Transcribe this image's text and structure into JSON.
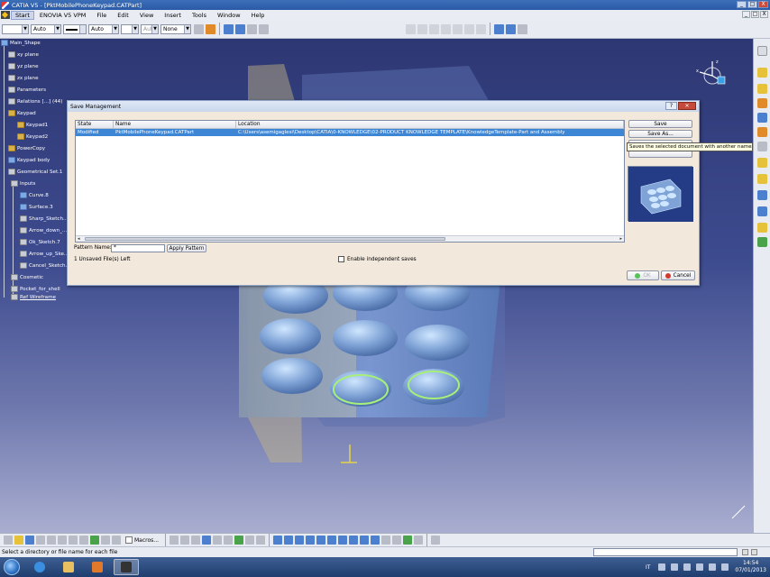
{
  "window": {
    "title": "CATIA V5 - [PktMobilePhoneKeypad.CATPart]",
    "controls": [
      "_",
      "□",
      "X"
    ]
  },
  "menu": {
    "items": [
      "Start",
      "ENOVIA V5 VPM",
      "File",
      "Edit",
      "View",
      "Insert",
      "Tools",
      "Window",
      "Help"
    ]
  },
  "toolbar": {
    "color_combo": "",
    "transparency_combo": "Auto",
    "linetype_combo": "Auto",
    "thickness_combo": "",
    "point_combo": "Aut",
    "layer_combo": "None"
  },
  "tree": {
    "nodes": [
      {
        "label": "Main_Shape",
        "icon": "part-icon"
      },
      {
        "label": "xy plane",
        "icon": "plane-icon"
      },
      {
        "label": "yz plane",
        "icon": "plane-icon"
      },
      {
        "label": "zx plane",
        "icon": "plane-icon"
      },
      {
        "label": "Parameters",
        "icon": "parameters-icon"
      },
      {
        "label": "Relations [...] (44)",
        "icon": "relations-icon"
      },
      {
        "label": "Keypad",
        "icon": "body-icon"
      },
      {
        "label": "Keypad1",
        "icon": "feature-icon"
      },
      {
        "label": "Keypad2",
        "icon": "feature-icon"
      },
      {
        "label": "PowerCopy",
        "icon": "powercopy-icon"
      },
      {
        "label": "Keypad body",
        "icon": "body-icon"
      },
      {
        "label": "Geometrical Set.1",
        "icon": "geoset-icon"
      },
      {
        "label": "Inputs",
        "icon": "geoset-icon"
      },
      {
        "label": "Curve.8",
        "icon": "curve-icon"
      },
      {
        "label": "Surface.3",
        "icon": "surface-icon"
      },
      {
        "label": "Sharp_Sketch...",
        "icon": "sketch-icon"
      },
      {
        "label": "Arrow_down_...",
        "icon": "sketch-icon"
      },
      {
        "label": "Ok_Sketch.7",
        "icon": "sketch-icon"
      },
      {
        "label": "Arrow_up_Ske...",
        "icon": "sketch-icon"
      },
      {
        "label": "Cancel_Sketch...",
        "icon": "sketch-icon"
      },
      {
        "label": "Cosmetic",
        "icon": "geoset-icon"
      },
      {
        "label": "Pocket_for_shell",
        "icon": "pocket-icon"
      },
      {
        "label": "Ref Wireframe",
        "icon": "geoset-icon"
      }
    ]
  },
  "dialog": {
    "title": "Save Management",
    "columns": [
      "State",
      "Name",
      "Location"
    ],
    "rows": [
      {
        "state": "Modified",
        "name": "PktMobilePhoneKeypad.CATPart",
        "location": "C:\\Users\\asemigaglesi\\Desktop\\CATIA\\0-KNOWLEDGE\\02-PRODUCT KNOWLEDGE TEMPLATE\\KnowledgeTemplate-Part and Assembly"
      }
    ],
    "buttons": {
      "save": "Save",
      "save_as": "Save As...",
      "ok": "OK",
      "cancel": "Cancel",
      "apply_pattern": "Apply Pattern"
    },
    "tooltip": "Saves the selected document with another name",
    "pattern_label": "Pattern Name:",
    "pattern_value": "*",
    "unsaved_text": "1 Unsaved File(s) Left",
    "independent_label": "Enable independent saves",
    "independent_checked": false
  },
  "bottom_toolbar": {
    "macros_label": "Macros..."
  },
  "status": {
    "message": "Select a directory or file name for each file",
    "command_value": ""
  },
  "taskbar": {
    "language": "IT",
    "time": "14:54",
    "date": "07/01/2013"
  },
  "colors": {
    "selection": "#3d86d6",
    "viewport_top": "#2d3773",
    "viewport_bottom": "#a9aed0",
    "dialog_bg": "#f2e9dc",
    "highlight_green": "#a6f07a"
  }
}
